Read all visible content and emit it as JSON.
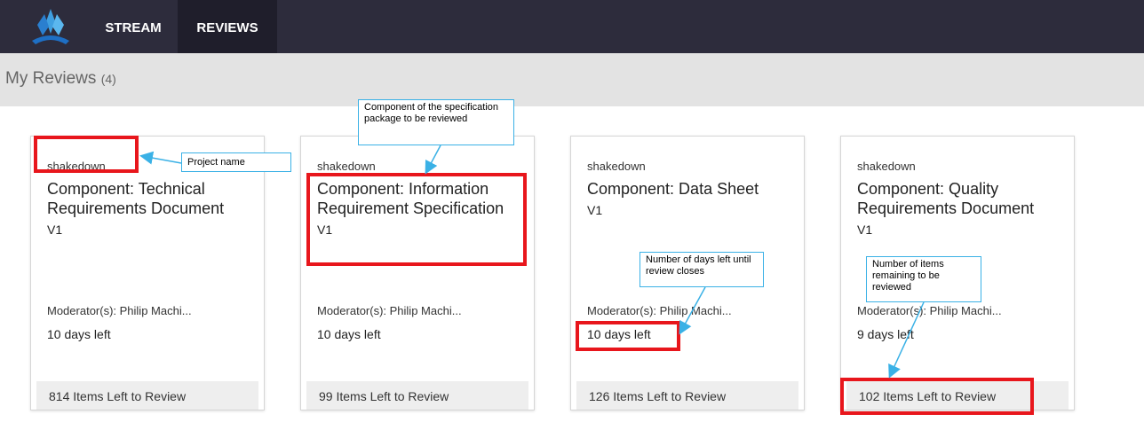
{
  "nav": {
    "tabs": [
      {
        "label": "STREAM"
      },
      {
        "label": "REVIEWS"
      }
    ],
    "active_tab": "REVIEWS"
  },
  "page": {
    "title": "My Reviews",
    "count": "(4)"
  },
  "reviews": [
    {
      "project": "shakedown",
      "title": "Component: Technical Requirements Document",
      "version": "V1",
      "moderator": "Moderator(s): Philip Machi...",
      "days_left": "10 days left",
      "items_left": "814 Items Left to Review"
    },
    {
      "project": "shakedown",
      "title": "Component: Information Requirement Specification",
      "version": "V1",
      "moderator": "Moderator(s): Philip Machi...",
      "days_left": "10 days left",
      "items_left": "99 Items Left to Review"
    },
    {
      "project": "shakedown",
      "title": "Component: Data Sheet",
      "version": "V1",
      "moderator": "Moderator(s): Philip Machi...",
      "days_left": "10 days left",
      "items_left": "126 Items Left to Review"
    },
    {
      "project": "shakedown",
      "title": "Component: Quality Requirements Document",
      "version": "V1",
      "moderator": "Moderator(s): Philip Machi...",
      "days_left": "9 days left",
      "items_left": "102 Items Left to Review"
    }
  ],
  "annotations": {
    "project_name": "Project name",
    "component": "Component of the specification package to be reviewed",
    "days": "Number of days left until review closes",
    "items": "Number of items remaining to be reviewed"
  },
  "colors": {
    "topbar": "#2d2c3c",
    "highlight": "#e8161c",
    "callout": "#3ab1e6"
  }
}
